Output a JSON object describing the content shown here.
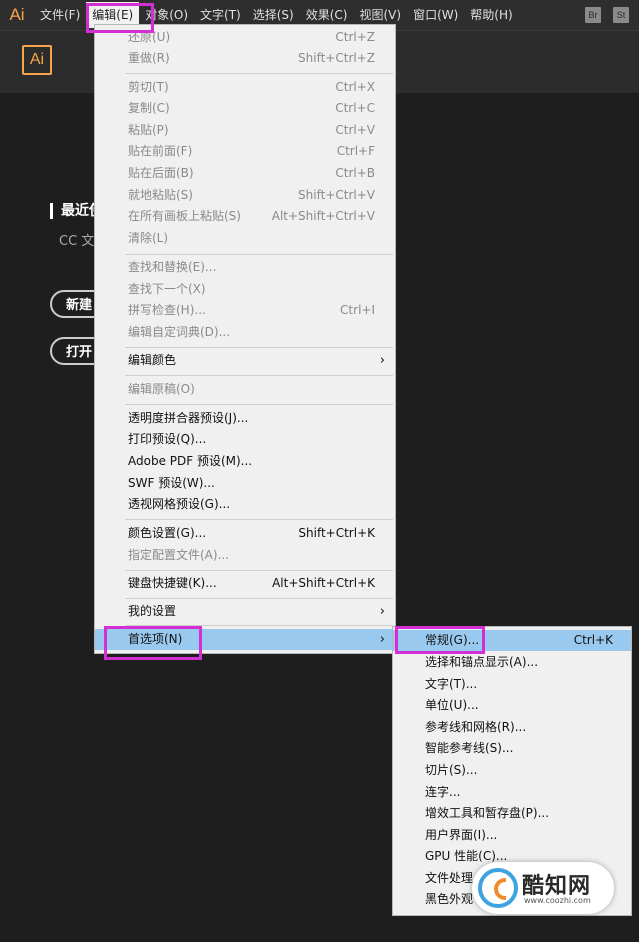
{
  "menubar": {
    "app_icon": "Ai",
    "items": [
      "文件(F)",
      "编辑(E)",
      "对象(O)",
      "文字(T)",
      "选择(S)",
      "效果(C)",
      "视图(V)",
      "窗口(W)",
      "帮助(H)"
    ],
    "right_badges": [
      "Br",
      "St"
    ]
  },
  "logo": "Ai",
  "home": {
    "recent_title": "最近使",
    "cc_text": "CC 文",
    "new_button": "新建",
    "open_button": "打开"
  },
  "edit_menu": {
    "items": [
      {
        "label": "还原(U)",
        "shortcut": "Ctrl+Z"
      },
      {
        "label": "重做(R)",
        "shortcut": "Shift+Ctrl+Z"
      },
      {
        "label": "剪切(T)",
        "shortcut": "Ctrl+X"
      },
      {
        "label": "复制(C)",
        "shortcut": "Ctrl+C"
      },
      {
        "label": "粘贴(P)",
        "shortcut": "Ctrl+V"
      },
      {
        "label": "贴在前面(F)",
        "shortcut": "Ctrl+F"
      },
      {
        "label": "贴在后面(B)",
        "shortcut": "Ctrl+B"
      },
      {
        "label": "就地粘贴(S)",
        "shortcut": "Shift+Ctrl+V"
      },
      {
        "label": "在所有画板上粘贴(S)",
        "shortcut": "Alt+Shift+Ctrl+V"
      },
      {
        "label": "清除(L)",
        "shortcut": ""
      },
      {
        "label": "查找和替换(E)...",
        "shortcut": ""
      },
      {
        "label": "查找下一个(X)",
        "shortcut": ""
      },
      {
        "label": "拼写检查(H)...",
        "shortcut": "Ctrl+I"
      },
      {
        "label": "编辑自定词典(D)...",
        "shortcut": ""
      },
      {
        "label": "编辑颜色",
        "shortcut": ""
      },
      {
        "label": "编辑原稿(O)",
        "shortcut": ""
      },
      {
        "label": "透明度拼合器预设(J)...",
        "shortcut": ""
      },
      {
        "label": "打印预设(Q)...",
        "shortcut": ""
      },
      {
        "label": "Adobe PDF 预设(M)...",
        "shortcut": ""
      },
      {
        "label": "SWF 预设(W)...",
        "shortcut": ""
      },
      {
        "label": "透视网格预设(G)...",
        "shortcut": ""
      },
      {
        "label": "颜色设置(G)...",
        "shortcut": "Shift+Ctrl+K"
      },
      {
        "label": "指定配置文件(A)...",
        "shortcut": ""
      },
      {
        "label": "键盘快捷键(K)...",
        "shortcut": "Alt+Shift+Ctrl+K"
      },
      {
        "label": "我的设置",
        "shortcut": ""
      },
      {
        "label": "首选项(N)",
        "shortcut": ""
      }
    ]
  },
  "preferences_submenu": {
    "items": [
      {
        "label": "常规(G)...",
        "shortcut": "Ctrl+K"
      },
      {
        "label": "选择和锚点显示(A)...",
        "shortcut": ""
      },
      {
        "label": "文字(T)...",
        "shortcut": ""
      },
      {
        "label": "单位(U)...",
        "shortcut": ""
      },
      {
        "label": "参考线和网格(R)...",
        "shortcut": ""
      },
      {
        "label": "智能参考线(S)...",
        "shortcut": ""
      },
      {
        "label": "切片(S)...",
        "shortcut": ""
      },
      {
        "label": "连字...",
        "shortcut": ""
      },
      {
        "label": "增效工具和暂存盘(P)...",
        "shortcut": ""
      },
      {
        "label": "用户界面(I)...",
        "shortcut": ""
      },
      {
        "label": "GPU 性能(C)...",
        "shortcut": ""
      },
      {
        "label": "文件处理",
        "shortcut": ""
      },
      {
        "label": "黑色外观",
        "shortcut": ""
      }
    ]
  },
  "watermark": {
    "text": "酷知网",
    "url": "www.coozhi.com"
  },
  "colors": {
    "annotation": "#d42fd4",
    "highlight": "#99c9ef",
    "ai_orange": "#f7a44a"
  }
}
